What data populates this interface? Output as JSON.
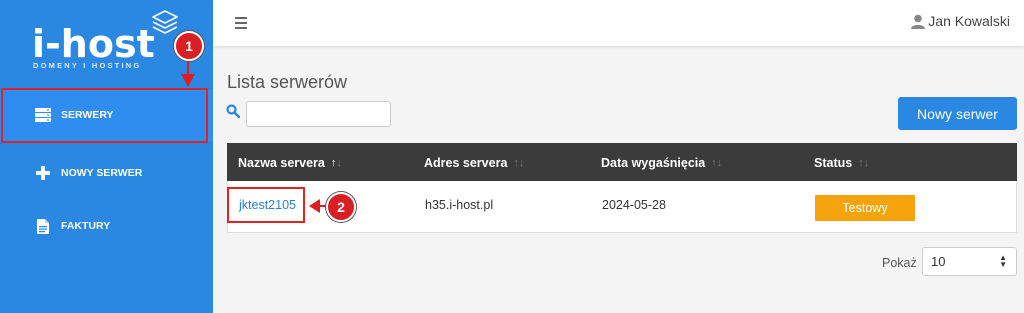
{
  "brand": {
    "name": "i-host",
    "tagline": "DOMENY I HOSTING"
  },
  "sidebar": {
    "items": [
      {
        "label": "SERWERY",
        "icon": "server-icon",
        "active": true
      },
      {
        "label": "NOWY SERWER",
        "icon": "plus-icon",
        "active": false
      },
      {
        "label": "FAKTURY",
        "icon": "document-icon",
        "active": false
      }
    ]
  },
  "topbar": {
    "user_name": "Jan Kowalski"
  },
  "main": {
    "title": "Lista serwerów",
    "search_placeholder": "",
    "new_button": "Nowy serwer",
    "table": {
      "columns": [
        "Nazwa servera",
        "Adres servera",
        "Data wygaśnięcia",
        "Status"
      ],
      "rows": [
        {
          "name": "jktest2105",
          "address": "h35.i-host.pl",
          "expires": "2024-05-28",
          "status": "Testowy"
        }
      ]
    },
    "pager": {
      "label": "Pokaż",
      "value": "10"
    }
  },
  "annotations": {
    "badge1": "1",
    "badge2": "2"
  },
  "colors": {
    "brand_blue": "#2a88e3",
    "header_dark": "#3b3b3b",
    "status_orange": "#f5a30a",
    "highlight_red": "#e02424"
  }
}
